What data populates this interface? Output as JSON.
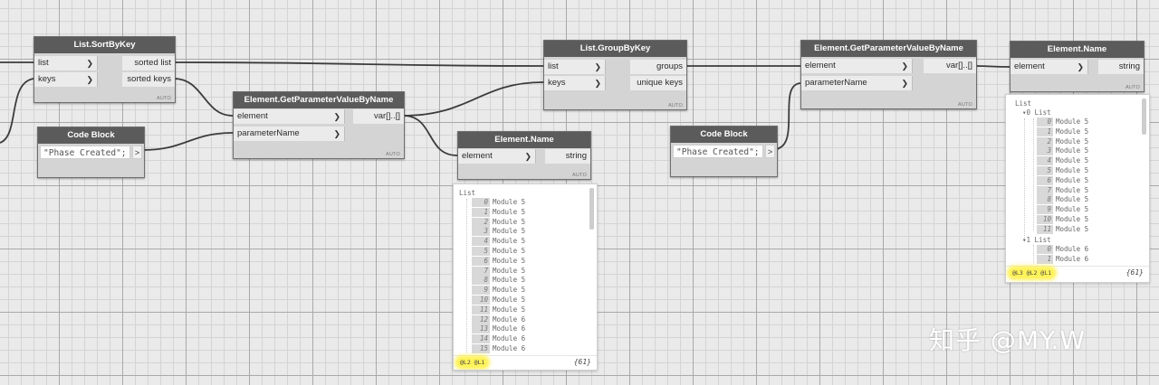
{
  "nodes": {
    "sortbykey": {
      "title": "List.SortByKey",
      "inputs": [
        "list",
        "keys"
      ],
      "outputs": [
        "sorted list",
        "sorted keys"
      ],
      "lacing": "AUTO"
    },
    "codeblock1": {
      "title": "Code Block",
      "code": "\"Phase Created\";",
      "out": ">"
    },
    "getparam1": {
      "title": "Element.GetParameterValueByName",
      "inputs": [
        "element",
        "parameterName"
      ],
      "outputs": [
        "var[]..[]"
      ],
      "lacing": "AUTO"
    },
    "name1": {
      "title": "Element.Name",
      "inputs": [
        "element"
      ],
      "outputs": [
        "string"
      ],
      "lacing": "AUTO"
    },
    "groupbykey": {
      "title": "List.GroupByKey",
      "inputs": [
        "list",
        "keys"
      ],
      "outputs": [
        "groups",
        "unique keys"
      ],
      "lacing": "AUTO"
    },
    "codeblock2": {
      "title": "Code Block",
      "code": "\"Phase Created\";",
      "out": ">"
    },
    "getparam2": {
      "title": "Element.GetParameterValueByName",
      "inputs": [
        "element",
        "parameterName"
      ],
      "outputs": [
        "var[]..[]"
      ],
      "lacing": "AUTO"
    },
    "name2": {
      "title": "Element.Name",
      "inputs": [
        "element"
      ],
      "outputs": [
        "string"
      ],
      "lacing": "AUTO"
    }
  },
  "preview1": {
    "header": "List",
    "items": [
      {
        "i": "0",
        "v": "Module 5"
      },
      {
        "i": "1",
        "v": "Module 5"
      },
      {
        "i": "2",
        "v": "Module 5"
      },
      {
        "i": "3",
        "v": "Module 5"
      },
      {
        "i": "4",
        "v": "Module 5"
      },
      {
        "i": "5",
        "v": "Module 5"
      },
      {
        "i": "6",
        "v": "Module 5"
      },
      {
        "i": "7",
        "v": "Module 5"
      },
      {
        "i": "8",
        "v": "Module 5"
      },
      {
        "i": "9",
        "v": "Module 5"
      },
      {
        "i": "10",
        "v": "Module 5"
      },
      {
        "i": "11",
        "v": "Module 5"
      },
      {
        "i": "12",
        "v": "Module 6"
      },
      {
        "i": "13",
        "v": "Module 6"
      },
      {
        "i": "14",
        "v": "Module 6"
      },
      {
        "i": "15",
        "v": "Module 6"
      }
    ],
    "levels": "@L2 @L1",
    "count": "{61}"
  },
  "preview2": {
    "header": "List",
    "sublist0": "▾0 List",
    "items0": [
      {
        "i": "0",
        "v": "Module 5"
      },
      {
        "i": "1",
        "v": "Module 5"
      },
      {
        "i": "2",
        "v": "Module 5"
      },
      {
        "i": "3",
        "v": "Module 5"
      },
      {
        "i": "4",
        "v": "Module 5"
      },
      {
        "i": "5",
        "v": "Module 5"
      },
      {
        "i": "6",
        "v": "Module 5"
      },
      {
        "i": "7",
        "v": "Module 5"
      },
      {
        "i": "8",
        "v": "Module 5"
      },
      {
        "i": "9",
        "v": "Module 5"
      },
      {
        "i": "10",
        "v": "Module 5"
      },
      {
        "i": "11",
        "v": "Module 5"
      }
    ],
    "sublist1": "▾1 List",
    "items1": [
      {
        "i": "0",
        "v": "Module 6"
      },
      {
        "i": "1",
        "v": "Module 6"
      }
    ],
    "levels": "@L3 @L2 @L1",
    "count": "{61}"
  },
  "watermark": "知乎 @MY.W",
  "colors": {
    "node_header": "#5b5b5b",
    "node_body": "#d4d4d4",
    "wire": "#3c3c3c",
    "highlight": "#fff35a"
  }
}
